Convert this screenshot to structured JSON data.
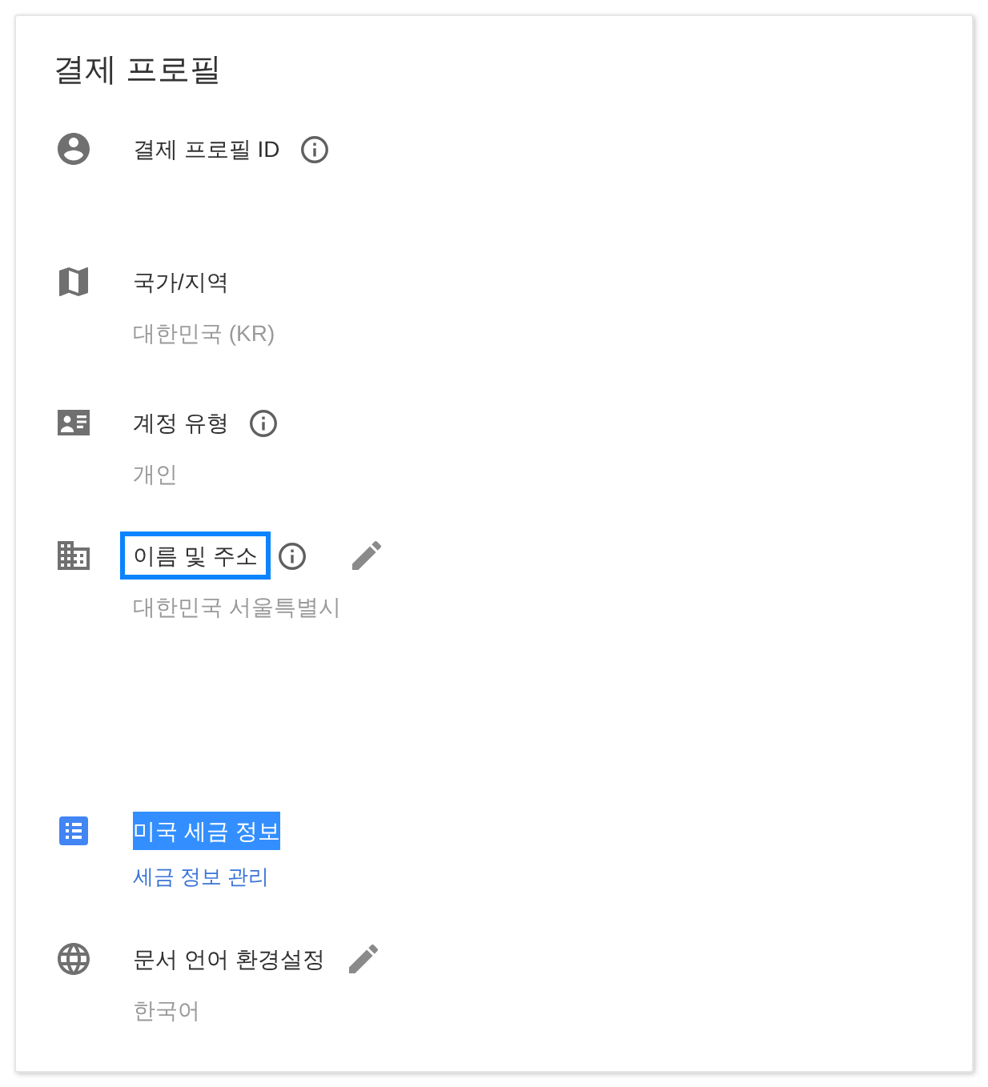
{
  "card": {
    "title": "결제 프로필"
  },
  "rows": [
    {
      "label": "결제 프로필 ID",
      "info": true,
      "editable": false,
      "focused": false,
      "text_selected": false,
      "icon_active": false
    },
    {
      "label": "국가/지역",
      "value": "대한민국 (KR)",
      "info": false,
      "editable": false,
      "focused": false,
      "text_selected": false,
      "icon_active": false
    },
    {
      "label": "계정 유형",
      "value": "개인",
      "info": true,
      "editable": false,
      "focused": false,
      "text_selected": false,
      "icon_active": false
    },
    {
      "label": "이름 및 주소",
      "value": "대한민국 서울특별시",
      "info": true,
      "editable": true,
      "focused": true,
      "text_selected": false,
      "icon_active": false
    },
    {
      "label": "미국 세금 정보",
      "link": "세금 정보 관리",
      "info": false,
      "editable": false,
      "focused": false,
      "text_selected": true,
      "icon_active": true
    },
    {
      "label": "문서 언어 환경설정",
      "value": "한국어",
      "info": false,
      "editable": true,
      "focused": false,
      "text_selected": false,
      "icon_active": false
    }
  ]
}
